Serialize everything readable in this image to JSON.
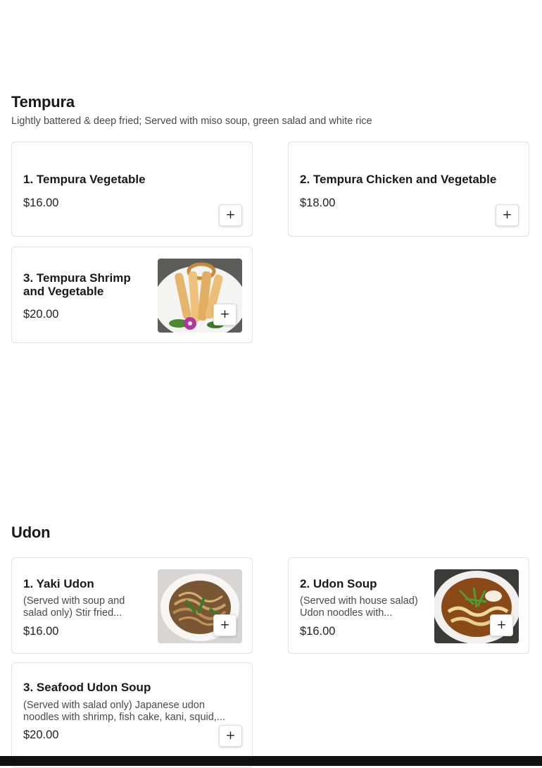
{
  "tempura": {
    "title": "Tempura",
    "description": "Lightly battered & deep fried; Served with miso soup, green salad and white rice",
    "items": [
      {
        "name": "1. Tempura Vegetable",
        "price": "$16.00"
      },
      {
        "name": "2. Tempura Chicken and Vegetable",
        "price": "$18.00"
      },
      {
        "name": "3. Tempura Shrimp and Vegetable",
        "price": "$20.00",
        "image": "tempura-shrimp-photo"
      }
    ]
  },
  "udon": {
    "title": "Udon",
    "items": [
      {
        "name": "1. Yaki Udon",
        "description": "(Served with soup and salad only) Stir fried...",
        "price": "$16.00",
        "image": "yaki-udon-photo"
      },
      {
        "name": "2. Udon Soup",
        "description": "(Served with house salad) Udon noodles with...",
        "price": "$16.00",
        "image": "udon-soup-photo"
      },
      {
        "name": "3. Seafood Udon Soup",
        "description": "(Served with salad only) Japanese udon noodles with shrimp, fish cake, kani, squid,...",
        "price": "$20.00"
      }
    ]
  },
  "add_button": {
    "icon": "plus-icon",
    "glyph": "+"
  }
}
